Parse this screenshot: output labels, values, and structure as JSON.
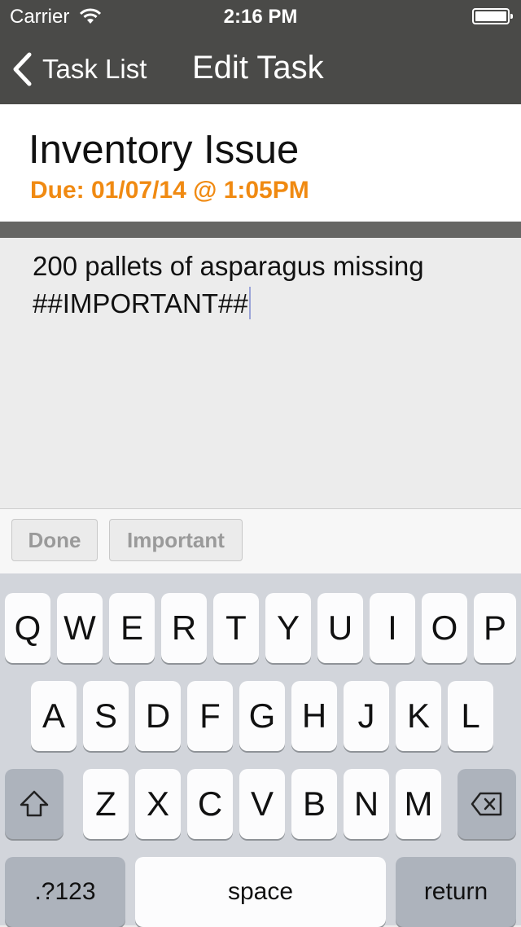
{
  "status_bar": {
    "carrier": "Carrier",
    "time": "2:16 PM"
  },
  "nav": {
    "back_label": "Task List",
    "title": "Edit Task"
  },
  "task": {
    "title": "Inventory Issue",
    "due": "Due: 01/07/14 @ 1:05PM",
    "notes_line1": "200 pallets of asparagus missing",
    "notes_line2": "##IMPORTANT##"
  },
  "accessory": {
    "done_label": "Done",
    "important_label": "Important"
  },
  "keyboard": {
    "row1": [
      "Q",
      "W",
      "E",
      "R",
      "T",
      "Y",
      "U",
      "I",
      "O",
      "P"
    ],
    "row2": [
      "A",
      "S",
      "D",
      "F",
      "G",
      "H",
      "J",
      "K",
      "L"
    ],
    "row3": [
      "Z",
      "X",
      "C",
      "V",
      "B",
      "N",
      "M"
    ],
    "shift_icon": "shift-icon",
    "delete_icon": "delete-icon",
    "numbers_label": ".?123",
    "space_label": "space",
    "return_label": "return"
  },
  "colors": {
    "nav_bg": "#4a4a48",
    "due_accent": "#f08a12",
    "keyboard_bg": "#d2d5db"
  }
}
